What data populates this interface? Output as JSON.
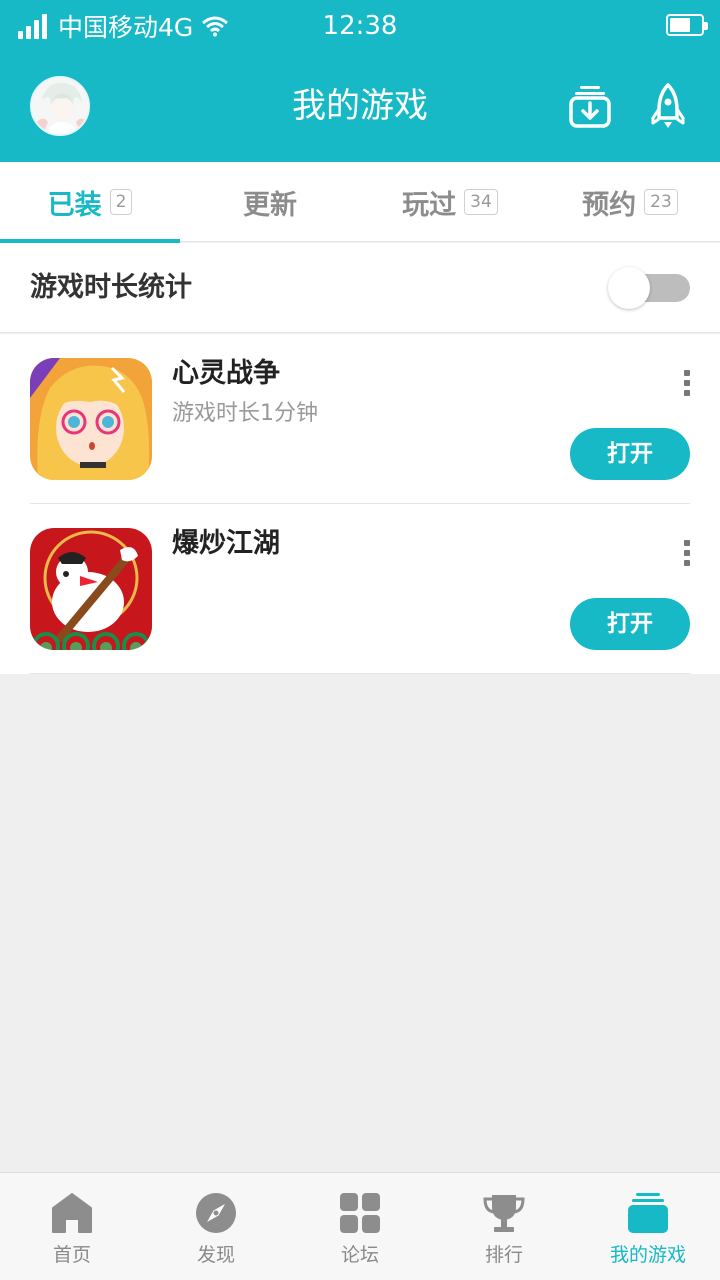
{
  "status_bar": {
    "carrier": "中国移动4G",
    "time": "12:38"
  },
  "header": {
    "title": "我的游戏",
    "avatar_icon": "avatar",
    "download_icon": "download-manager-icon",
    "speed_icon": "rocket-icon"
  },
  "tabs": [
    {
      "label": "已装",
      "count": "2",
      "active": true
    },
    {
      "label": "更新",
      "count": "",
      "active": false
    },
    {
      "label": "玩过",
      "count": "34",
      "active": false
    },
    {
      "label": "预约",
      "count": "23",
      "active": false
    }
  ],
  "stats": {
    "label": "游戏时长统计",
    "toggle_on": false
  },
  "games": [
    {
      "name": "心灵战争",
      "play_time": "游戏时长1分钟",
      "button": "打开"
    },
    {
      "name": "爆炒江湖",
      "play_time": "",
      "button": "打开"
    }
  ],
  "bottom_nav": [
    {
      "label": "首页",
      "icon": "home-icon",
      "active": false
    },
    {
      "label": "发现",
      "icon": "compass-icon",
      "active": false
    },
    {
      "label": "论坛",
      "icon": "grid-icon",
      "active": false
    },
    {
      "label": "排行",
      "icon": "trophy-icon",
      "active": false
    },
    {
      "label": "我的游戏",
      "icon": "my-games-icon",
      "active": true
    }
  ],
  "colors": {
    "accent": "#17b9c6",
    "background": "#efefef",
    "inactive": "#8a8a8a"
  }
}
